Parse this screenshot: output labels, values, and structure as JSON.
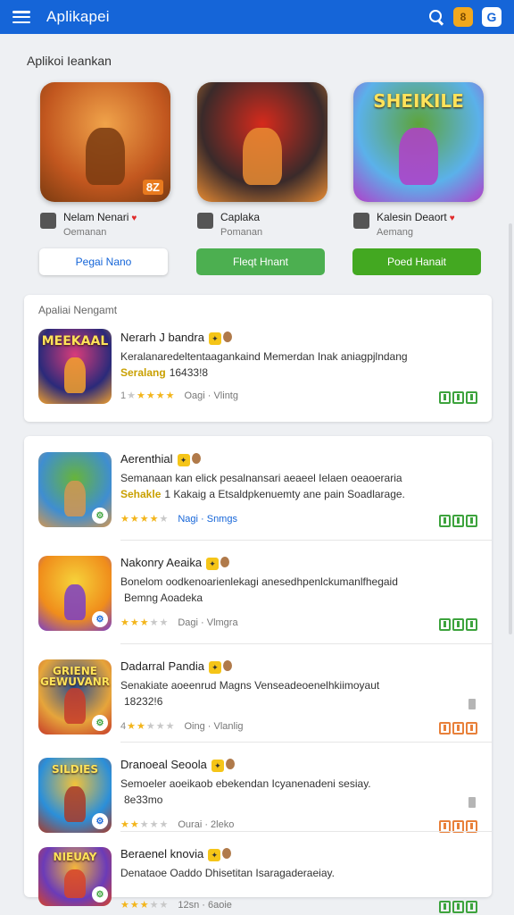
{
  "header": {
    "title": "Aplikapei",
    "coin_badge": "8",
    "shop_badge": "G"
  },
  "section_title": "Aplikoi Ieankan",
  "featured": [
    {
      "name": "Nelam Nenari",
      "sub": "Oemanan",
      "button": "Pegai Nano",
      "heart": true,
      "art_label": "8Z",
      "colors": [
        "#c2571f",
        "#f0a34a",
        "#7a3b10"
      ]
    },
    {
      "name": "Caplaka",
      "sub": "Pomanan",
      "button": "Fleqt Hnant",
      "heart": false,
      "art_label": "",
      "colors": [
        "#3a2a2a",
        "#d62a1c",
        "#e98c33"
      ]
    },
    {
      "name": "Kalesin Deaort",
      "sub": "Aemang",
      "button": "Poed Hanait",
      "heart": true,
      "art_label": "SHEIKILE",
      "colors": [
        "#5bb1ea",
        "#5da43a",
        "#b23ec9"
      ]
    }
  ],
  "recommended": {
    "label": "Apaliai Nengamt",
    "item": {
      "title": "Nerarh J bandra",
      "desc_line1": "Keralanaredeltentaagankaind Memerdan Inak aniagpjlndang",
      "desc_hl": "Seralang",
      "desc_line2": "16433!8",
      "meta": "Oagi · Vlintg",
      "stars_prefix": "1",
      "stars_on": 4,
      "icon_label": "MEEKAAL",
      "colors": [
        "#2b2a7a",
        "#d93c7a",
        "#f2a12d"
      ]
    }
  },
  "list": [
    {
      "title": "Aerenthial",
      "desc_line1": "Semanaan kan elick pesalnansari aeaeel Ielaen oeaoeraria",
      "desc_hl": "Sehakle",
      "desc_line2": "1 Kakaig a Etsaldpkenuemty ane pain Soadlarage.",
      "meta": "Nagi · Snmgs",
      "meta_color": "blue-green",
      "stars_prefix": "",
      "stars_on": 4,
      "install_color": "green",
      "icon_label": "",
      "colors": [
        "#3f8ed1",
        "#67b43a",
        "#d29752"
      ]
    },
    {
      "title": "Nakonry Aeaika",
      "desc_line1": "Bonelom oodkenoarienlekagi anesedhpenlckumanlfhegaid",
      "desc_hl": "",
      "desc_line2": "Bemng Aoadeka",
      "meta": "Dagi · Vlmgra",
      "meta_color": "grey",
      "stars_prefix": "",
      "stars_on": 3,
      "install_color": "green",
      "icon_label": "",
      "colors": [
        "#f08d1b",
        "#f6d33a",
        "#7b3fc6"
      ]
    },
    {
      "title": "Dadarral Pandia",
      "desc_line1": "Senakiate aoeenrud Magns Venseadeoenelhkiimoyaut",
      "desc_hl": "",
      "desc_line2": "18232!6",
      "meta": "Oing · Vlanlig",
      "meta_color": "grey",
      "stars_prefix": "4",
      "stars_on": 2,
      "install_color": "orange",
      "icon_label": "GRIENE GEWUVANR",
      "colors": [
        "#e6a53b",
        "#264b8f",
        "#c73d2a"
      ]
    },
    {
      "title": "Dranoeal Seoola",
      "desc_line1": "Semoeler aoeikaob ebekendan Icyanenadeni sesiay.",
      "desc_hl": "",
      "desc_line2": "8e33mo",
      "meta": "Ourai · 2leko",
      "meta_color": "grey",
      "stars_prefix": "",
      "stars_on": 2,
      "install_color": "orange",
      "icon_label": "SILDIES",
      "colors": [
        "#2b8fd9",
        "#f2c23a",
        "#a83b2a"
      ]
    },
    {
      "title": "Beraenel knovia",
      "desc_line1": "Denataoe Oaddo Dhisetitan Isaragaderaeiay.",
      "desc_hl": "",
      "desc_line2": "",
      "meta": "12sn · 6aoie",
      "meta_color": "grey",
      "stars_prefix": "",
      "stars_on": 3,
      "install_color": "green",
      "icon_label": "NIEUAY",
      "colors": [
        "#6b3bb8",
        "#f4b63a",
        "#d6432a"
      ]
    }
  ],
  "colors": {
    "accent": "#1565d8",
    "install_green": "#3da33d",
    "install_orange": "#e8803a",
    "star": "#f3b51b"
  }
}
